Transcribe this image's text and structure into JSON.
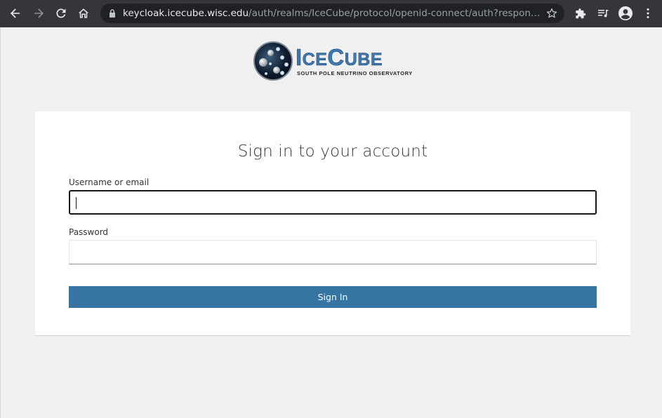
{
  "browser": {
    "url_host": "keycloak.icecube.wisc.edu",
    "url_path": "/auth/realms/IceCube/protocol/openid-connect/auth?respon…",
    "icons": [
      "back-icon",
      "forward-icon",
      "reload-icon",
      "home-icon",
      "lock-icon",
      "star-icon",
      "extensions-icon",
      "media-queue-icon",
      "profile-icon",
      "menu-icon"
    ]
  },
  "logo": {
    "title_big1": "I",
    "title_small1": "CE",
    "title_big2": "C",
    "title_small2": "UBE",
    "subtitle": "South Pole Neutrino Observatory"
  },
  "login": {
    "heading": "Sign in to your account",
    "username_label": "Username or email",
    "username_value": "",
    "password_label": "Password",
    "password_value": "",
    "submit_label": "Sign In"
  },
  "colors": {
    "button": "#3574a3",
    "toolbar": "#35363a",
    "omnibox": "#202124"
  }
}
